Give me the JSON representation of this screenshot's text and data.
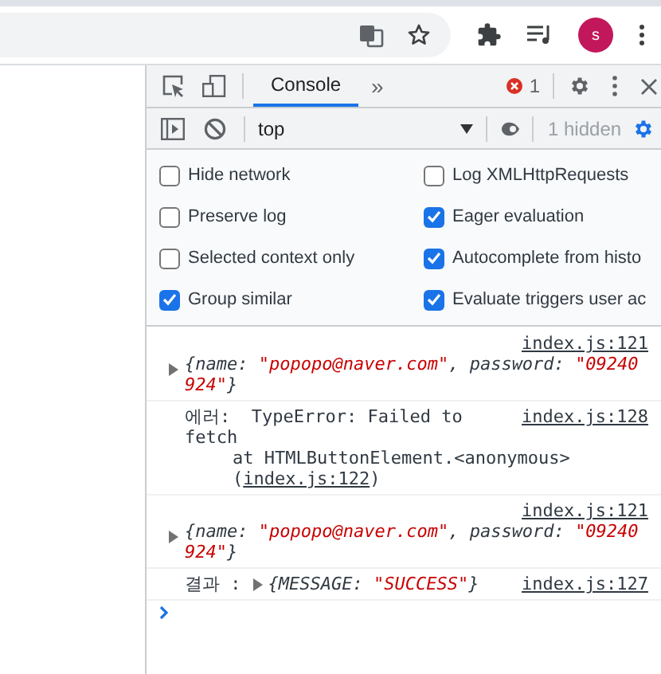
{
  "browser": {
    "avatar": "s"
  },
  "devtools": {
    "tabs": [
      {
        "label": "Console",
        "selected": true
      }
    ],
    "more": "»",
    "error_count": "1",
    "context": "top",
    "hidden": "1 hidden",
    "settings": [
      {
        "label": "Hide network",
        "checked": false
      },
      {
        "label": "Log XMLHttpRequests",
        "checked": false
      },
      {
        "label": "Preserve log",
        "checked": false
      },
      {
        "label": "Eager evaluation",
        "checked": true
      },
      {
        "label": "Selected context only",
        "checked": false
      },
      {
        "label": "Autocomplete from histo",
        "checked": true
      },
      {
        "label": "Group similar",
        "checked": true
      },
      {
        "label": "Evaluate triggers user ac",
        "checked": true
      }
    ],
    "messages": [
      {
        "kind": "object",
        "source": "index.js:121",
        "segments": [
          {
            "kind": "plain",
            "text": "{name: "
          },
          {
            "kind": "string",
            "text": "\"popopo@naver.com\""
          },
          {
            "kind": "plain",
            "text": ", password: "
          },
          {
            "kind": "string",
            "text": "\"09240924\""
          },
          {
            "kind": "plain",
            "text": "}"
          }
        ]
      },
      {
        "kind": "error",
        "source": "index.js:128",
        "prefix": "에러:",
        "text": "TypeError: Failed to fetch",
        "stack": "at HTMLButtonElement.<anonymous> (",
        "stack_link": "index.js:122",
        "stack_end": ")"
      },
      {
        "kind": "object",
        "source": "index.js:121",
        "segments": [
          {
            "kind": "plain",
            "text": "{name: "
          },
          {
            "kind": "string",
            "text": "\"popopo@naver.com\""
          },
          {
            "kind": "plain",
            "text": ", password: "
          },
          {
            "kind": "string",
            "text": "\"09240924\""
          },
          {
            "kind": "plain",
            "text": "}"
          }
        ]
      },
      {
        "kind": "result",
        "source": "index.js:127",
        "prefix": "결과 :",
        "segments": [
          {
            "kind": "plain",
            "text": "{MESSAGE: "
          },
          {
            "kind": "string",
            "text": "\"SUCCESS\""
          },
          {
            "kind": "plain",
            "text": "}"
          }
        ]
      }
    ]
  }
}
